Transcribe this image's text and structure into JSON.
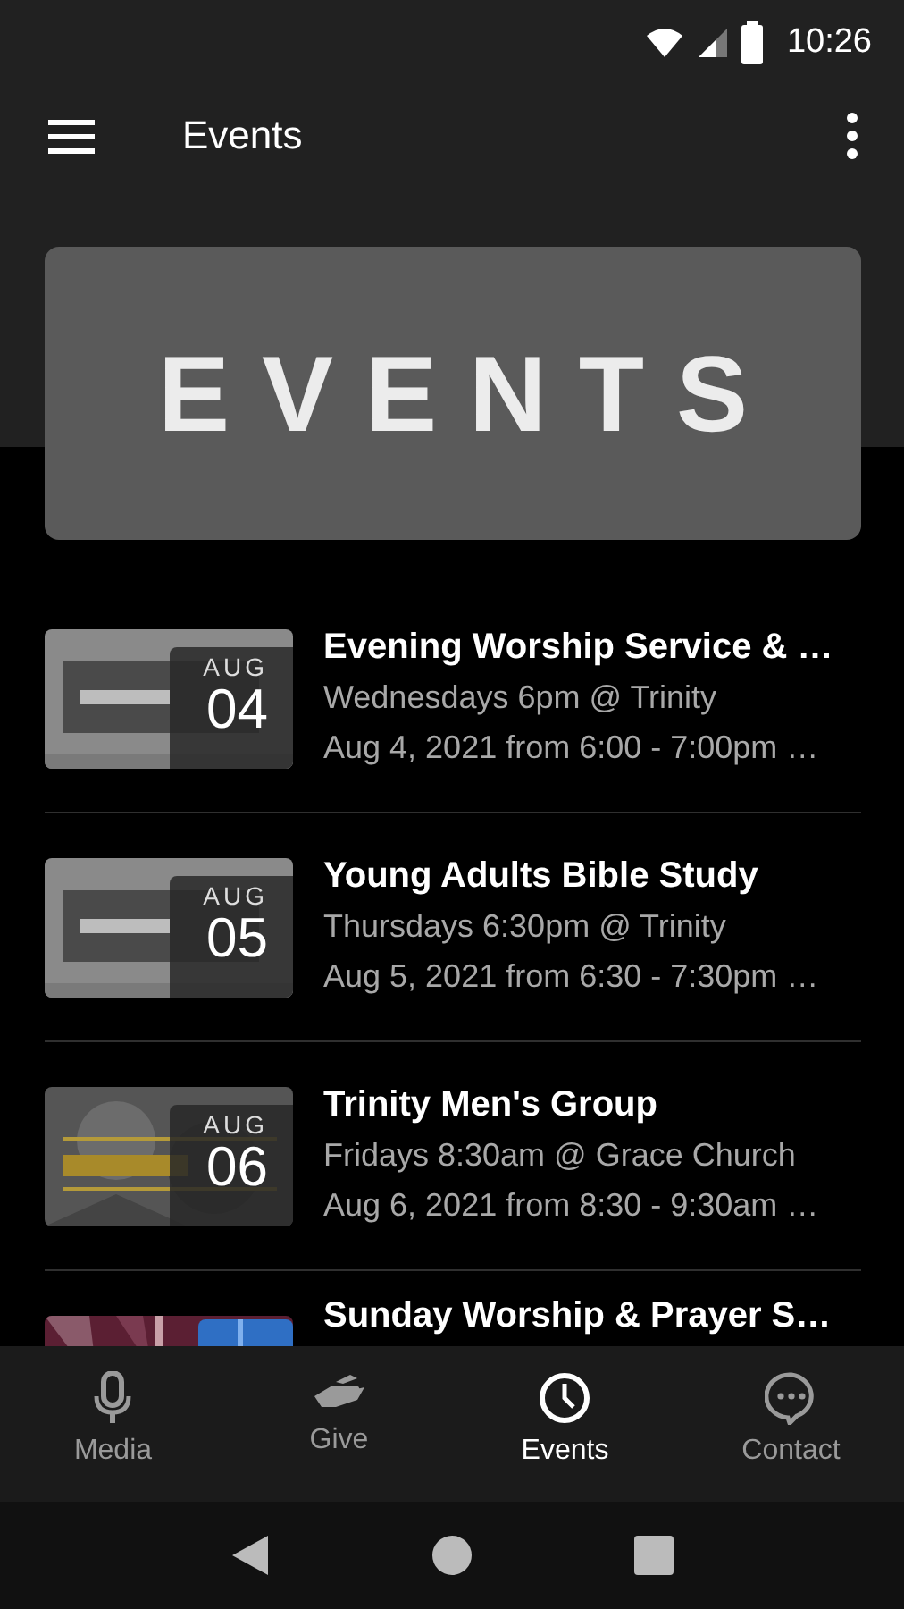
{
  "status_bar": {
    "time": "10:26"
  },
  "app_bar": {
    "title": "Events"
  },
  "banner": {
    "text": "EVENTS"
  },
  "events": [
    {
      "title": "Evening Worship Service & …",
      "schedule": "Wednesdays 6pm @ Trinity",
      "date_time": "Aug 4, 2021 from 6:00 - 7:00pm …",
      "month": "AUG",
      "day": "04"
    },
    {
      "title": "Young Adults Bible Study",
      "schedule": "Thursdays 6:30pm @ Trinity",
      "date_time": "Aug 5, 2021 from 6:30 - 7:30pm …",
      "month": "AUG",
      "day": "05"
    },
    {
      "title": "Trinity Men's Group",
      "schedule": "Fridays 8:30am @ Grace Church",
      "date_time": "Aug 6, 2021 from 8:30 - 9:30am …",
      "month": "AUG",
      "day": "06"
    },
    {
      "title": "Sunday Worship & Prayer S…"
    }
  ],
  "bottom_nav": [
    {
      "label": "Media",
      "selected": false
    },
    {
      "label": "Give",
      "selected": false
    },
    {
      "label": "Events",
      "selected": true
    },
    {
      "label": "Contact",
      "selected": false
    }
  ]
}
